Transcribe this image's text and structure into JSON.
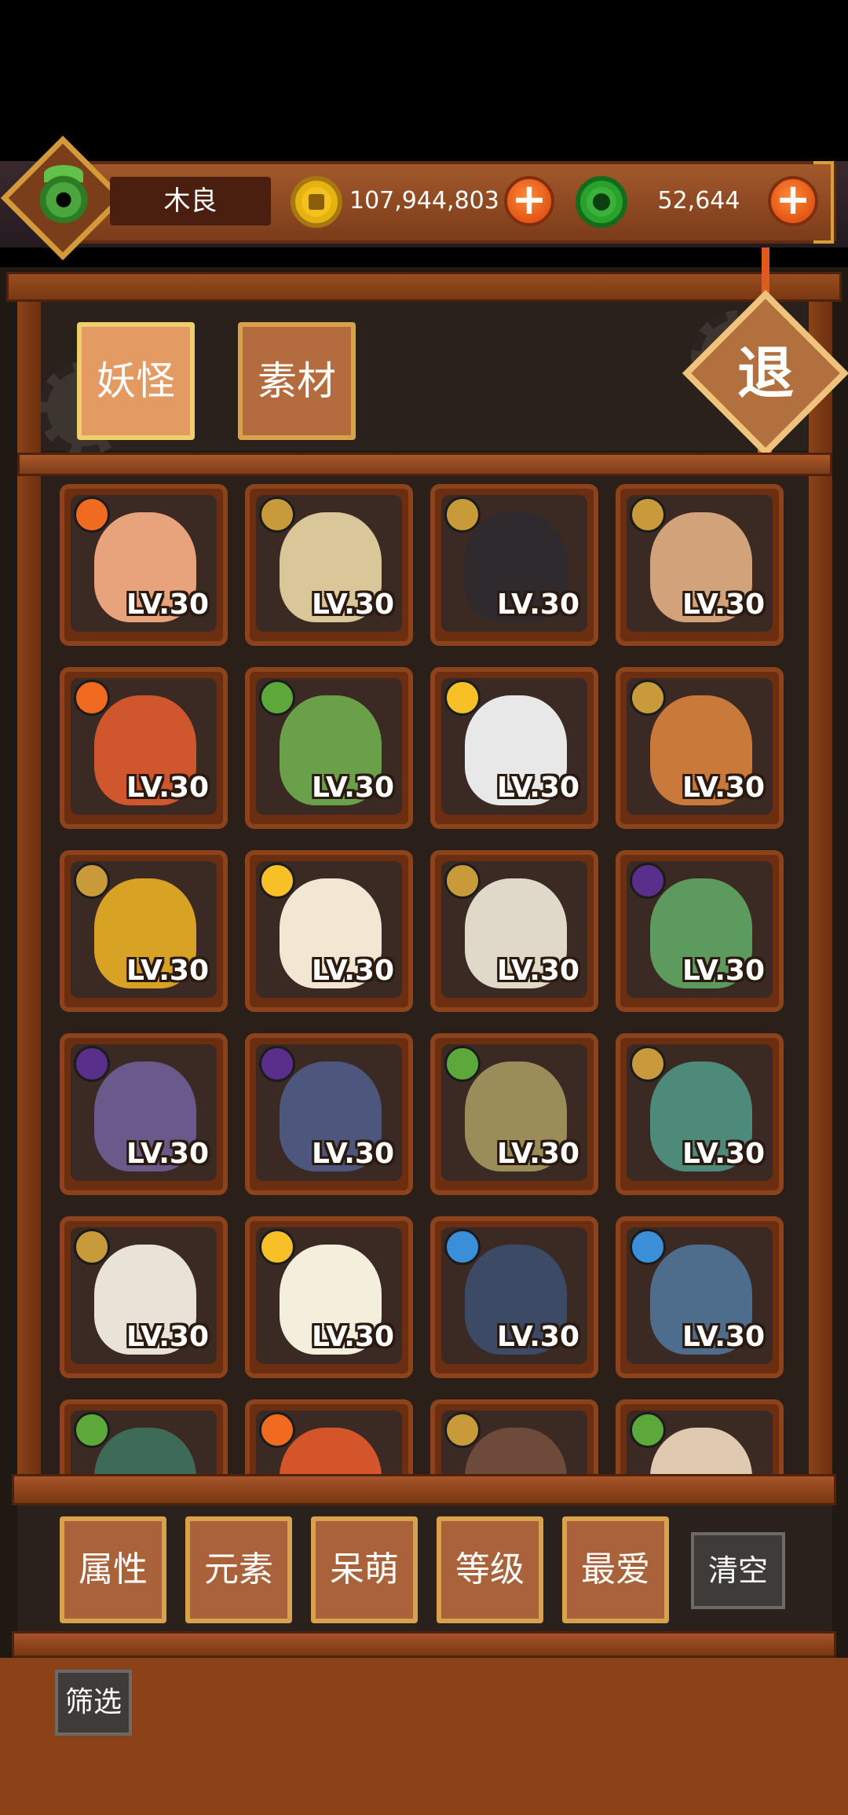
{
  "header": {
    "player_name": "木良",
    "gold_amount": "107,944,803",
    "jade_amount": "52,644"
  },
  "tabs": [
    {
      "label": "妖怪",
      "active": true
    },
    {
      "label": "素材",
      "active": false
    }
  ],
  "exit_label": "退",
  "cards": [
    {
      "element": "fire",
      "level": "LV.30",
      "color": "#e8a37d"
    },
    {
      "element": "earth",
      "level": "LV.30",
      "color": "#d9c79a"
    },
    {
      "element": "earth",
      "level": "LV.30",
      "color": "#2e2a2e"
    },
    {
      "element": "earth",
      "level": "LV.30",
      "color": "#d2a27a"
    },
    {
      "element": "fire",
      "level": "LV.30",
      "color": "#d0562e"
    },
    {
      "element": "wood",
      "level": "LV.30",
      "color": "#6aa04a"
    },
    {
      "element": "light",
      "level": "LV.30",
      "color": "#e8e8e8"
    },
    {
      "element": "earth",
      "level": "LV.30",
      "color": "#c97a3a"
    },
    {
      "element": "earth",
      "level": "LV.30",
      "color": "#d8a325"
    },
    {
      "element": "light",
      "level": "LV.30",
      "color": "#f1e7d2"
    },
    {
      "element": "earth",
      "level": "LV.30",
      "color": "#e0d8c8"
    },
    {
      "element": "dark",
      "level": "LV.30",
      "color": "#5c9a5e"
    },
    {
      "element": "dark",
      "level": "LV.30",
      "color": "#6a5a8c"
    },
    {
      "element": "dark",
      "level": "LV.30",
      "color": "#4d567c"
    },
    {
      "element": "wood",
      "level": "LV.30",
      "color": "#9a8d5a"
    },
    {
      "element": "earth",
      "level": "LV.30",
      "color": "#4d8a7a"
    },
    {
      "element": "earth",
      "level": "LV.30",
      "color": "#e9e2d6"
    },
    {
      "element": "light",
      "level": "LV.30",
      "color": "#f4eedd"
    },
    {
      "element": "water",
      "level": "LV.30",
      "color": "#3c4a66"
    },
    {
      "element": "water",
      "level": "LV.30",
      "color": "#4e6d8c"
    },
    {
      "element": "wood",
      "level": "",
      "color": "#3e6a58"
    },
    {
      "element": "fire",
      "level": "",
      "color": "#d5552a"
    },
    {
      "element": "earth",
      "level": "",
      "color": "#6e4a3a"
    },
    {
      "element": "wood",
      "level": "",
      "color": "#dfc9b0"
    }
  ],
  "element_colors": {
    "fire": "#f06a1f",
    "earth": "#c99a3a",
    "wood": "#5da83a",
    "light": "#f6c026",
    "dark": "#5a2f8c",
    "water": "#3a8fd8"
  },
  "filters": [
    {
      "label": "属性"
    },
    {
      "label": "元素"
    },
    {
      "label": "呆萌"
    },
    {
      "label": "等级"
    },
    {
      "label": "最爱"
    }
  ],
  "clear_label": "清空",
  "screen_label": "筛选"
}
